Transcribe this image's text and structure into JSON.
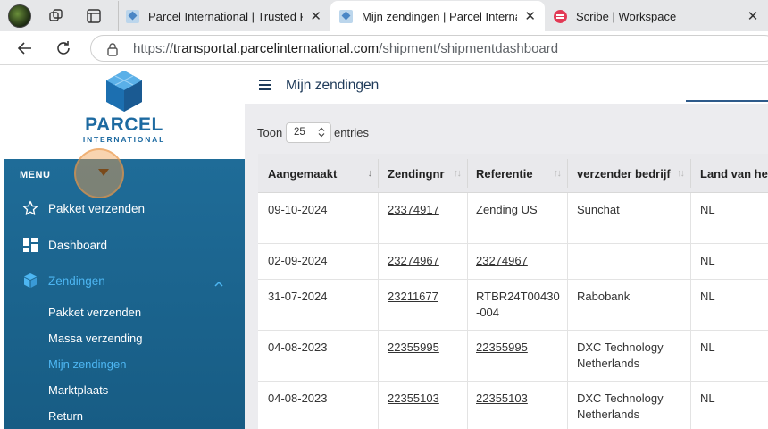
{
  "browser": {
    "tabs": [
      {
        "title": "Parcel International | Trusted Partr",
        "active": false
      },
      {
        "title": "Mijn zendingen | Parcel Internatio",
        "active": true
      },
      {
        "title": "Scribe | Workspace",
        "active": false
      }
    ],
    "url_prefix": "https://",
    "url_host": "transportal.parcelinternational.com",
    "url_path": "/shipment/shipmentdashboard"
  },
  "logo": {
    "main": "PARCEL",
    "sub": "INTERNATIONAL"
  },
  "sidebar": {
    "menu_title": "MENU",
    "items": [
      {
        "label": "Pakket verzenden",
        "icon": "star-icon"
      },
      {
        "label": "Dashboard",
        "icon": "dashboard-icon"
      },
      {
        "label": "Zendingen",
        "icon": "box-icon",
        "active": true
      }
    ],
    "sub_items": [
      {
        "label": "Pakket verzenden"
      },
      {
        "label": "Massa verzending"
      },
      {
        "label": "Mijn zendingen",
        "active": true
      },
      {
        "label": "Marktplaats"
      },
      {
        "label": "Return"
      }
    ]
  },
  "page": {
    "title": "Mijn zendingen"
  },
  "table_controls": {
    "show_label": "Toon",
    "page_size": "25",
    "entries_label": "entries"
  },
  "table": {
    "columns": [
      "Aangemaakt",
      "Zendingnr",
      "Referentie",
      "verzender bedrijf",
      "Land van her"
    ],
    "rows": [
      {
        "created": "09-10-2024",
        "shipment_no": "23374917",
        "reference": "Zending US",
        "reference_link": false,
        "company": "Sunchat",
        "country": "NL"
      },
      {
        "created": "02-09-2024",
        "shipment_no": "23274967",
        "reference": "23274967",
        "reference_link": true,
        "company": "",
        "country": "NL"
      },
      {
        "created": "31-07-2024",
        "shipment_no": "23211677",
        "reference": "RTBR24T00430-004",
        "reference_link": false,
        "company": "Rabobank",
        "country": "NL"
      },
      {
        "created": "04-08-2023",
        "shipment_no": "22355995",
        "reference": "22355995",
        "reference_link": true,
        "company": "DXC Technology Netherlands",
        "country": "NL"
      },
      {
        "created": "04-08-2023",
        "shipment_no": "22355103",
        "reference": "22355103",
        "reference_link": true,
        "company": "DXC Technology Netherlands",
        "country": "NL"
      }
    ]
  },
  "colors": {
    "sidebar_bg": "#1f6c98",
    "accent": "#4db6f2",
    "brand": "#1d6aa1",
    "highlight": "#f0a050"
  }
}
